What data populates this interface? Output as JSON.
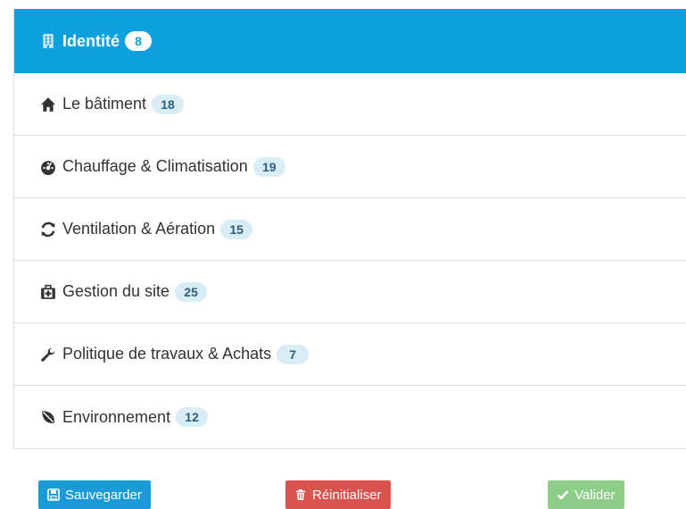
{
  "menu": {
    "items": [
      {
        "label": "Identité",
        "count": "8",
        "icon": "building-icon",
        "active": true
      },
      {
        "label": "Le bâtiment",
        "count": "18",
        "icon": "home-icon"
      },
      {
        "label": "Chauffage & Climatisation",
        "count": "19",
        "icon": "dashboard-icon"
      },
      {
        "label": "Ventilation & Aération",
        "count": "15",
        "icon": "refresh-icon"
      },
      {
        "label": "Gestion du site",
        "count": "25",
        "icon": "medkit-icon"
      },
      {
        "label": "Politique de travaux & Achats",
        "count": "7",
        "icon": "wrench-icon"
      },
      {
        "label": "Environnement",
        "count": "12",
        "icon": "leaf-icon"
      }
    ]
  },
  "actions": {
    "save_label": "Sauvegarder",
    "reset_label": "Réinitialiser",
    "validate_label": "Valider"
  },
  "colors": {
    "active_bg": "#0ea0dc",
    "badge_bg": "#d9edf7",
    "save": "#1a9bd7",
    "reset": "#d9534f",
    "validate": "#8fce8a"
  }
}
